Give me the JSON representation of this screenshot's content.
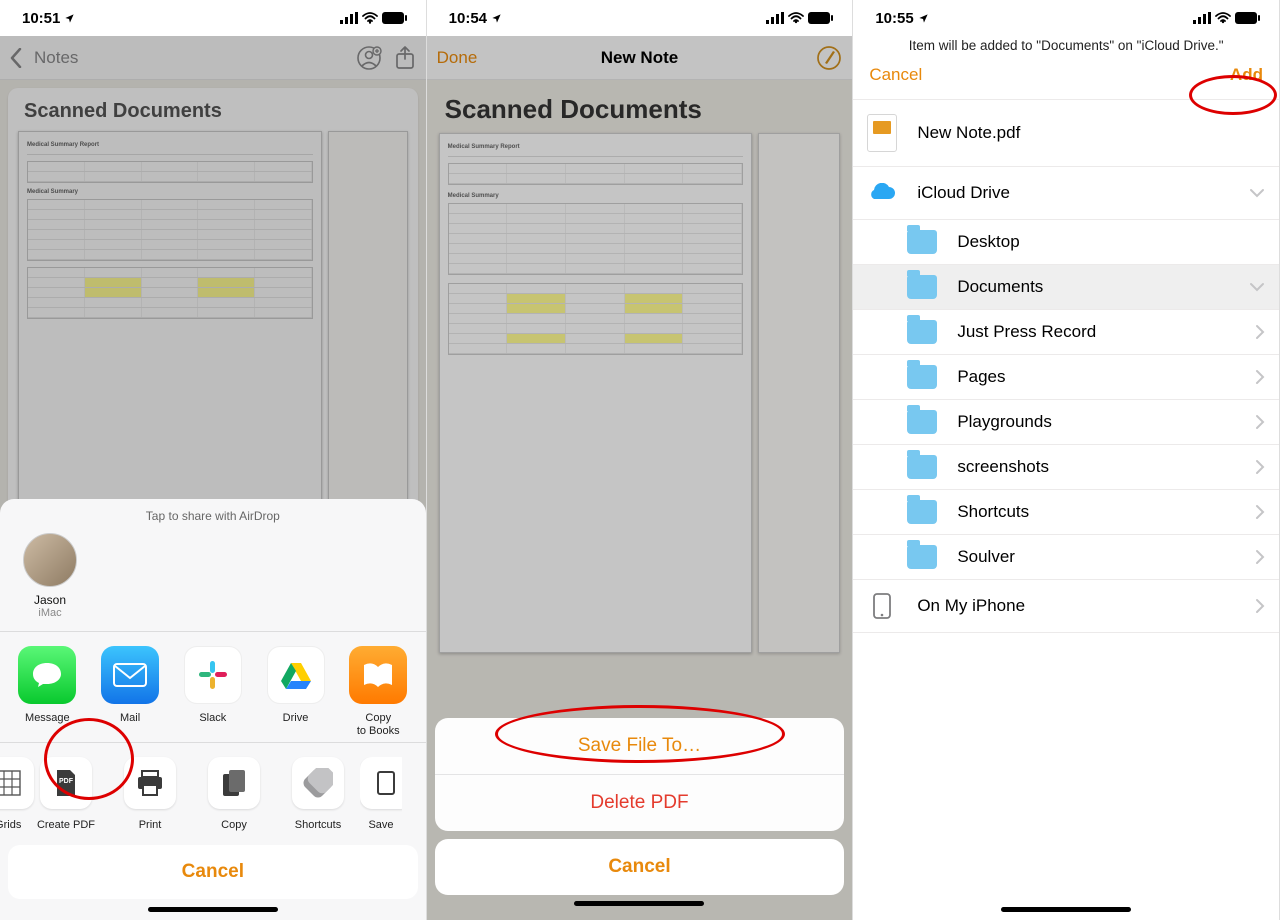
{
  "panel1": {
    "time": "10:51",
    "back_label": "Notes",
    "doc_title": "Scanned Documents",
    "airdrop_hint": "Tap to share with AirDrop",
    "contact": {
      "name": "Jason",
      "device": "iMac"
    },
    "apps": [
      {
        "id": "message",
        "label": "Message"
      },
      {
        "id": "mail",
        "label": "Mail"
      },
      {
        "id": "slack",
        "label": "Slack"
      },
      {
        "id": "drive",
        "label": "Drive"
      },
      {
        "id": "books",
        "label": "Copy\nto Books"
      }
    ],
    "actions_left_partial": "& Grids",
    "actions": [
      {
        "id": "createpdf",
        "label": "Create PDF"
      },
      {
        "id": "print",
        "label": "Print"
      },
      {
        "id": "copy",
        "label": "Copy"
      },
      {
        "id": "shortcuts",
        "label": "Shortcuts"
      }
    ],
    "actions_right_partial": "Save",
    "cancel": "Cancel"
  },
  "panel2": {
    "time": "10:54",
    "done": "Done",
    "title": "New Note",
    "doc_title": "Scanned Documents",
    "save": "Save File To…",
    "delete": "Delete PDF",
    "cancel": "Cancel"
  },
  "panel3": {
    "time": "10:55",
    "message": "Item will be added to \"Documents\" on \"iCloud Drive.\"",
    "cancel": "Cancel",
    "add": "Add",
    "file": "New Note.pdf",
    "sect_icloud": "iCloud Drive",
    "sect_onphone": "On My iPhone",
    "folders": [
      {
        "name": "Desktop",
        "selected": false,
        "chev": false
      },
      {
        "name": "Documents",
        "selected": true,
        "chev": true
      },
      {
        "name": "Just Press Record",
        "selected": false,
        "chev": true
      },
      {
        "name": "Pages",
        "selected": false,
        "chev": true
      },
      {
        "name": "Playgrounds",
        "selected": false,
        "chev": true
      },
      {
        "name": "screenshots",
        "selected": false,
        "chev": true
      },
      {
        "name": "Shortcuts",
        "selected": false,
        "chev": true
      },
      {
        "name": "Soulver",
        "selected": false,
        "chev": true
      }
    ]
  }
}
